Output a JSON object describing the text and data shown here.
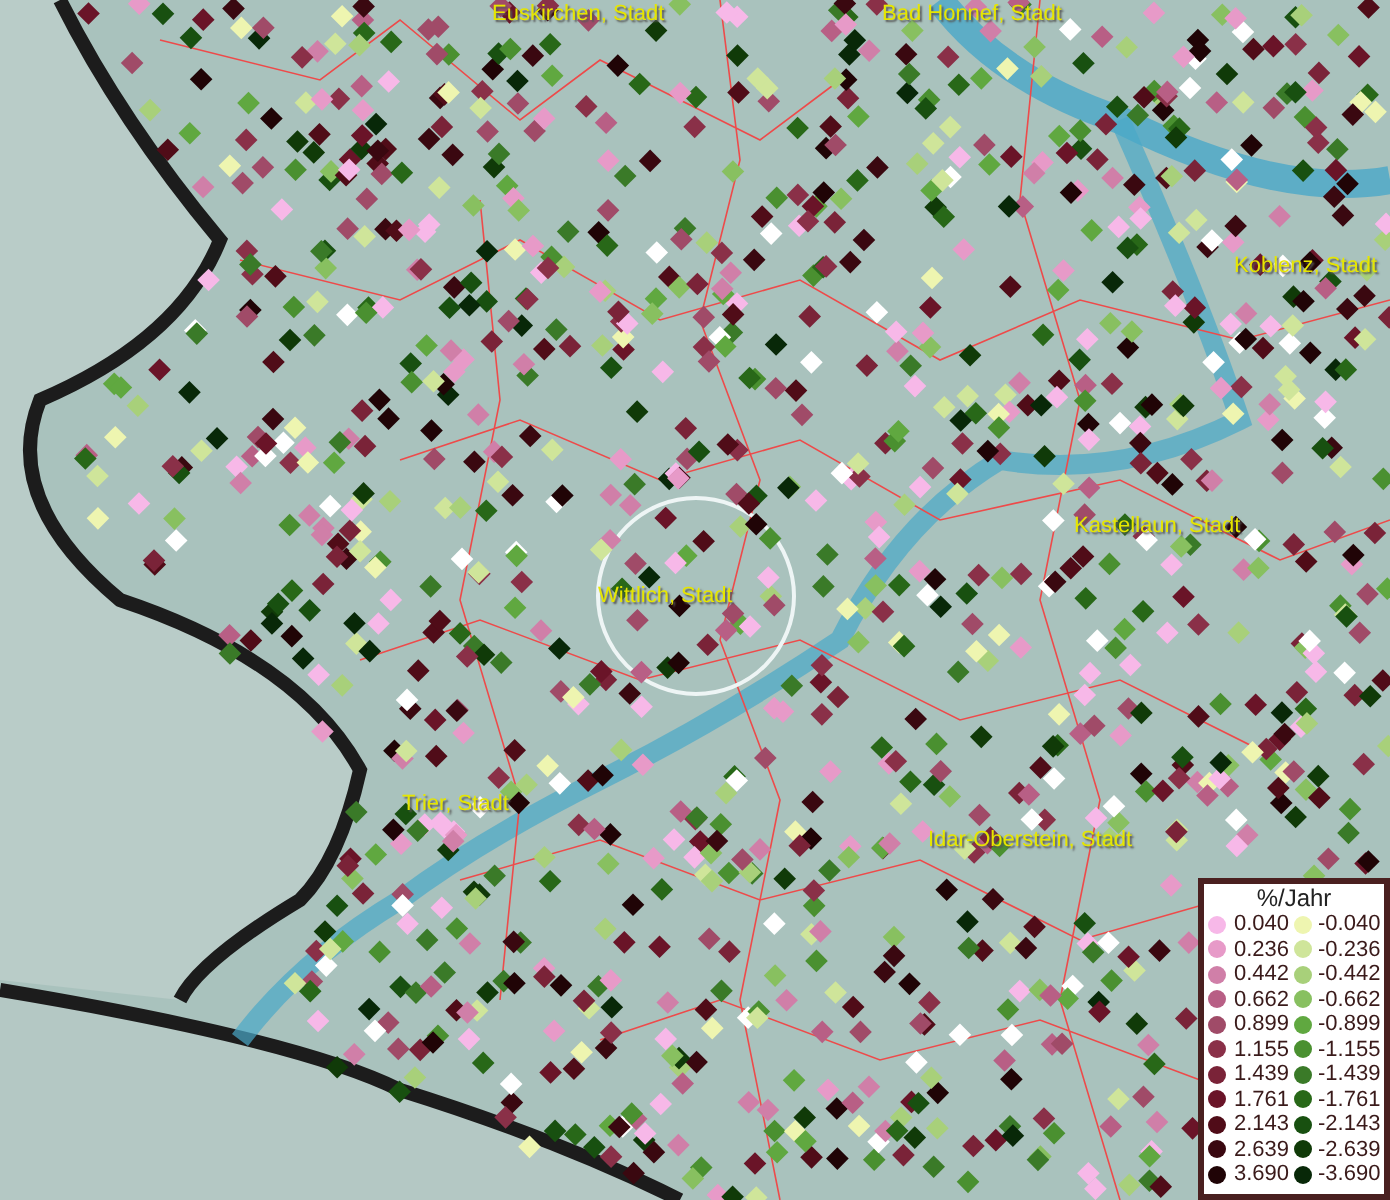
{
  "places": [
    {
      "name": "Euskirchen, Stadt"
    },
    {
      "name": "Bad Honnef, Stadt"
    },
    {
      "name": "Koblenz, Stadt"
    },
    {
      "name": "Kastellaun, Stadt"
    },
    {
      "name": "Wittlich, Stadt"
    },
    {
      "name": "Trier, Stadt"
    },
    {
      "name": "Idar-Oberstein, Stadt"
    }
  ],
  "legend": {
    "title": "%/Jahr",
    "positive": [
      {
        "label": "0.040",
        "color": "#f7b8e8"
      },
      {
        "label": "0.236",
        "color": "#e79ac8"
      },
      {
        "label": "0.442",
        "color": "#d07fa8"
      },
      {
        "label": "0.662",
        "color": "#b85f85"
      },
      {
        "label": "0.899",
        "color": "#a04b68"
      },
      {
        "label": "1.155",
        "color": "#8a3048"
      },
      {
        "label": "1.439",
        "color": "#7a2338"
      },
      {
        "label": "1.761",
        "color": "#6a1428"
      },
      {
        "label": "2.143",
        "color": "#500c18"
      },
      {
        "label": "2.639",
        "color": "#3a0810"
      },
      {
        "label": "3.690",
        "color": "#200406"
      }
    ],
    "negative": [
      {
        "label": "-0.040",
        "color": "#eef5b0"
      },
      {
        "label": "-0.236",
        "color": "#cfe59a"
      },
      {
        "label": "-0.442",
        "color": "#a8d07a"
      },
      {
        "label": "-0.662",
        "color": "#88c060"
      },
      {
        "label": "-0.899",
        "color": "#60a840"
      },
      {
        "label": "-1.155",
        "color": "#4a9030"
      },
      {
        "label": "-1.439",
        "color": "#3a7a28"
      },
      {
        "label": "-1.761",
        "color": "#286818"
      },
      {
        "label": "-2.143",
        "color": "#185010"
      },
      {
        "label": "-2.639",
        "color": "#103a08"
      },
      {
        "label": "-3.690",
        "color": "#082808"
      }
    ]
  }
}
